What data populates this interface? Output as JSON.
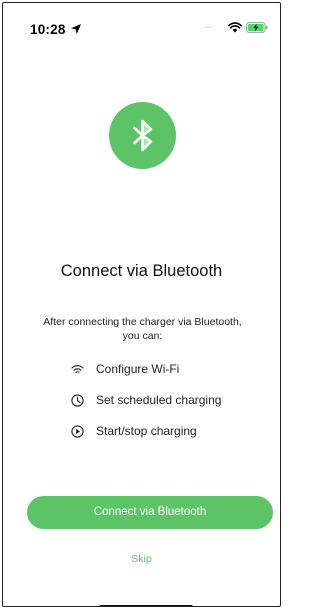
{
  "status_bar": {
    "time": "10:28",
    "signal_text": "....",
    "icons": [
      "location-arrow-icon",
      "wifi-icon",
      "battery-charging-icon"
    ]
  },
  "hero": {
    "icon": "bluetooth-icon",
    "accent_color": "#5cc466"
  },
  "title": "Connect via Bluetooth",
  "description": "After connecting the charger via Bluetooth, you can:",
  "features": [
    {
      "icon": "wifi-icon",
      "label": "Configure Wi-Fi"
    },
    {
      "icon": "clock-icon",
      "label": "Set scheduled charging"
    },
    {
      "icon": "play-circle-icon",
      "label": "Start/stop charging"
    }
  ],
  "actions": {
    "connect_label": "Connect via Bluetooth",
    "skip_label": "Skip"
  }
}
